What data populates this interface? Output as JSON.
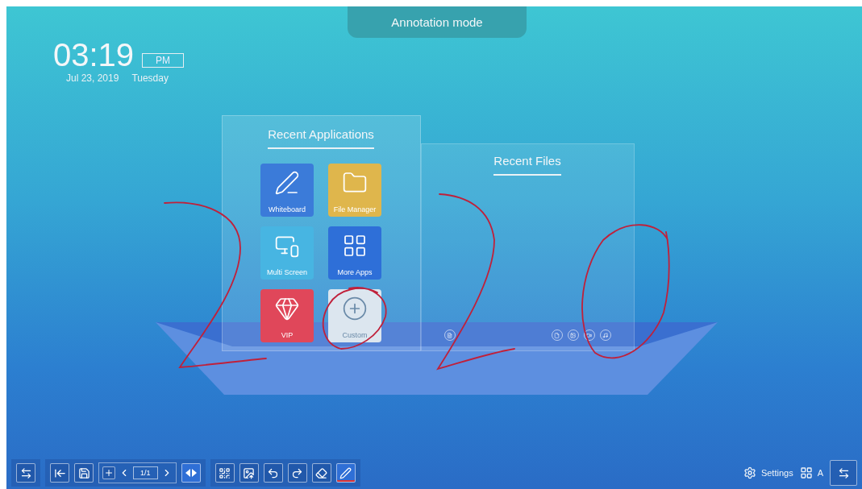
{
  "mode_banner": "Annotation mode",
  "clock": {
    "time": "03:19",
    "period": "PM",
    "date": "Jul 23, 2019",
    "weekday": "Tuesday"
  },
  "recent_applications": {
    "title": "Recent Applications",
    "apps": [
      {
        "label": "Whiteboard",
        "color": "#3b7bd9"
      },
      {
        "label": "File Manager",
        "color": "#dfb64c"
      },
      {
        "label": "Multi Screen",
        "color": "#47b5e2"
      },
      {
        "label": "More Apps",
        "color": "#2e6fd8"
      },
      {
        "label": "VIP",
        "color": "#e0475a"
      },
      {
        "label": "Custom",
        "color": "#dce6ef"
      }
    ]
  },
  "recent_files": {
    "title": "Recent Files"
  },
  "toolbar": {
    "page": "1/1",
    "tools": [
      {
        "selected": false
      },
      {
        "selected": false
      },
      {
        "selected": false
      },
      {
        "selected": false
      },
      {
        "selected": false
      },
      {
        "selected": true
      }
    ]
  },
  "status": {
    "settings": "Settings",
    "apps": "A"
  }
}
